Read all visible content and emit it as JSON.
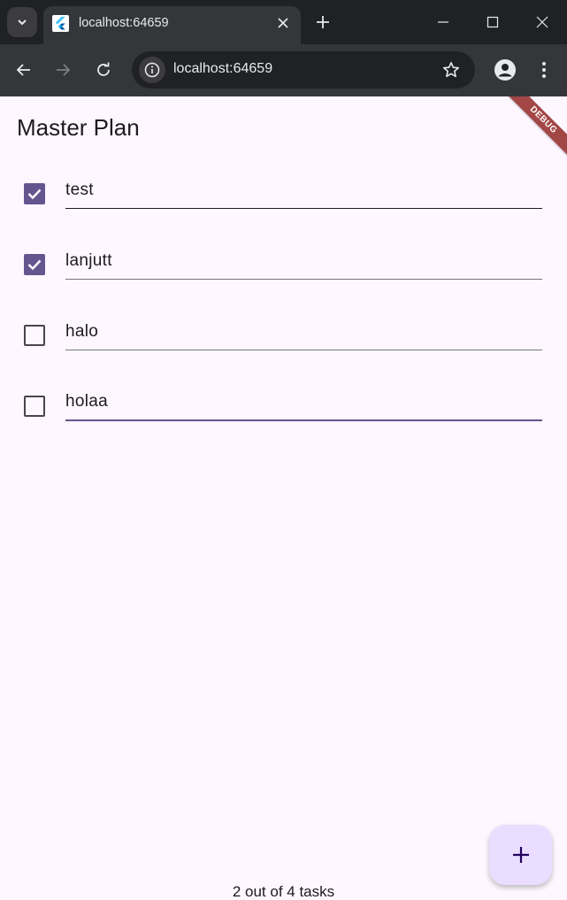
{
  "browser": {
    "tab_title": "localhost:64659",
    "url": "localhost:64659"
  },
  "app": {
    "title": "Master Plan",
    "debug_banner": "DEBUG",
    "accent_color": "#65558f",
    "tasks": [
      {
        "description": "test",
        "complete": true
      },
      {
        "description": "lanjutt",
        "complete": true
      },
      {
        "description": "halo",
        "complete": false
      },
      {
        "description": "holaa",
        "complete": false
      }
    ],
    "progress_text": "2 out of 4 tasks"
  }
}
